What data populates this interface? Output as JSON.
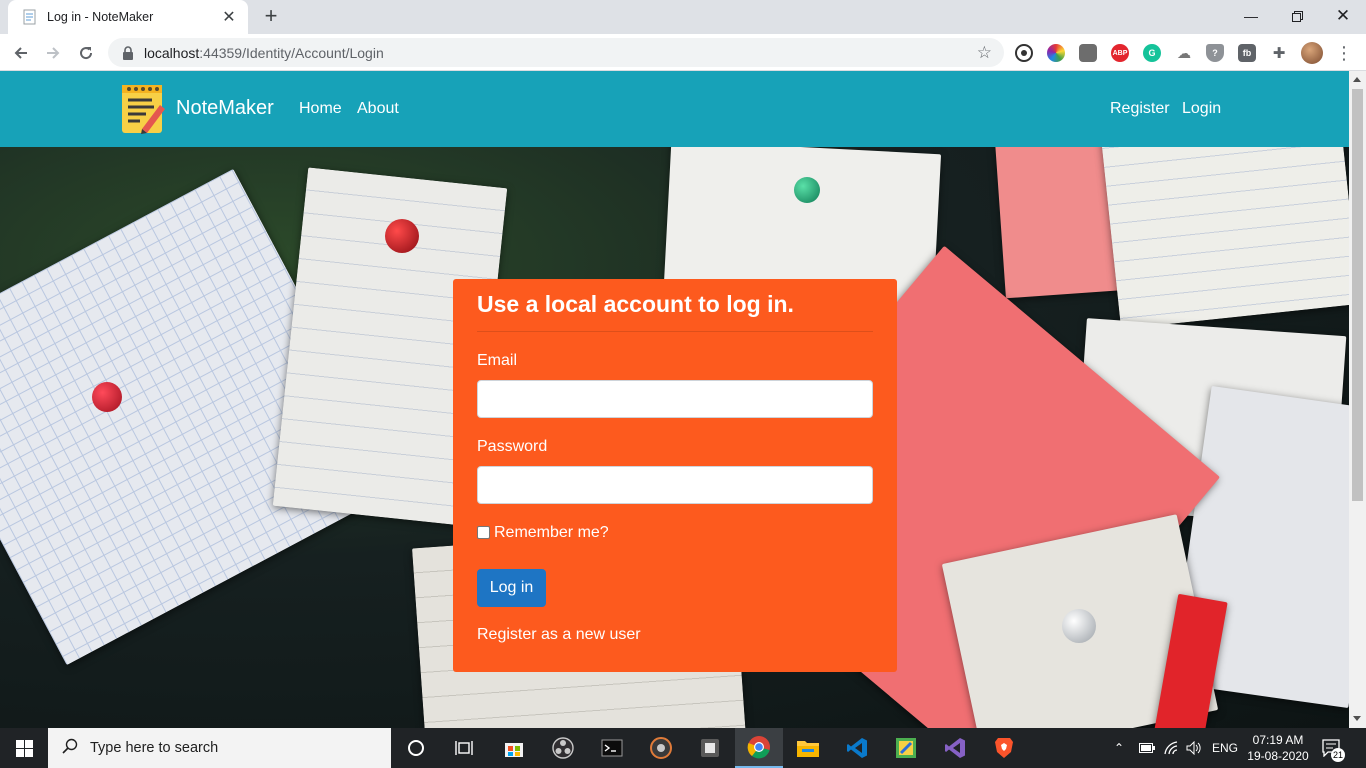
{
  "browser": {
    "tab_title": "Log in - NoteMaker",
    "url_host": "localhost",
    "url_rest": ":44359/Identity/Account/Login"
  },
  "site": {
    "brand": "NoteMaker",
    "nav_left": [
      "Home",
      "About"
    ],
    "nav_right": [
      "Register",
      "Login"
    ]
  },
  "login": {
    "heading": "Use a local account to log in.",
    "email_label": "Email",
    "email_value": "",
    "password_label": "Password",
    "password_value": "",
    "remember_label": "Remember me?",
    "submit_label": "Log in",
    "register_link": "Register as a new user"
  },
  "taskbar": {
    "search_placeholder": "Type here to search",
    "language": "ENG",
    "time": "07:19 AM",
    "date": "19-08-2020",
    "notification_count": "21"
  },
  "colors": {
    "navbar": "#17a2b8",
    "card": "#fd5a1e",
    "button": "#1e75c4"
  },
  "icons": {
    "extensions": [
      "record-icon",
      "color-wheel-icon",
      "briefcase-icon",
      "adblock-icon",
      "grammarly-icon",
      "cloud-icon",
      "shield-icon",
      "fb-icon",
      "puzzle-icon",
      "profile-avatar"
    ]
  }
}
